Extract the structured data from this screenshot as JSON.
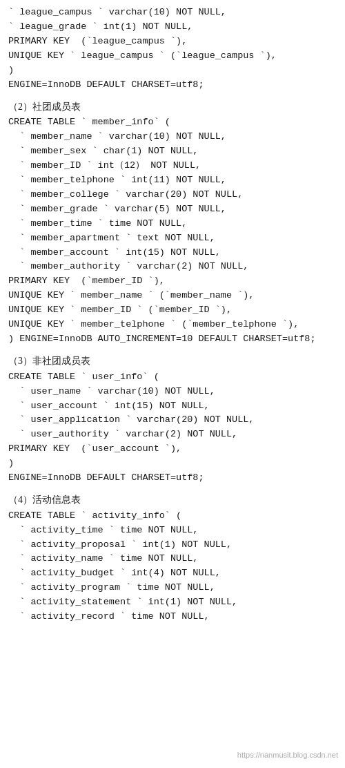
{
  "sections": [
    {
      "id": "top-fragment",
      "code_lines": [
        "` league_campus ` varchar(10) NOT NULL,",
        "` league_grade ` int(1) NOT NULL,",
        "PRIMARY KEY  (`league_campus `),",
        "UNIQUE KEY ` league_campus ` (`league_campus `),",
        ")",
        "ENGINE=InnoDB DEFAULT CHARSET=utf8;"
      ]
    },
    {
      "id": "section-2",
      "title": "（2）社团成员表",
      "code_lines": [
        "CREATE TABLE ` member_info` (",
        "  ` member_name ` varchar(10) NOT NULL,",
        "  ` member_sex ` char(1) NOT NULL,",
        "  ` member_ID ` int（12） NOT NULL,",
        "  ` member_telphone ` int(11) NOT NULL,",
        "  ` member_college ` varchar(20) NOT NULL,",
        "  ` member_grade ` varchar(5) NOT NULL,",
        "  ` member_time ` time NOT NULL,",
        "  ` member_apartment ` text NOT NULL,",
        "  ` member_account ` int(15) NOT NULL,",
        "  ` member_authority ` varchar(2) NOT NULL,",
        "PRIMARY KEY  (`member_ID `),",
        "UNIQUE KEY ` member_name ` (`member_name `),",
        "UNIQUE KEY ` member_ID ` (`member_ID `),",
        "UNIQUE KEY ` member_telphone ` (`member_telphone `),",
        ") ENGINE=InnoDB AUTO_INCREMENT=10 DEFAULT CHARSET=utf8;"
      ]
    },
    {
      "id": "section-3",
      "title": "（3）非社团成员表",
      "code_lines": [
        "CREATE TABLE ` user_info` (",
        "  ` user_name ` varchar(10) NOT NULL,",
        "  ` user_account ` int(15) NOT NULL,",
        "  ` user_application ` varchar(20) NOT NULL,",
        "  ` user_authority ` varchar(2) NOT NULL,",
        "PRIMARY KEY  (`user_account `),",
        ")",
        "ENGINE=InnoDB DEFAULT CHARSET=utf8;"
      ]
    },
    {
      "id": "section-4",
      "title": "（4）活动信息表",
      "code_lines": [
        "CREATE TABLE ` activity_info` (",
        "  ` activity_time ` time NOT NULL,",
        "  ` activity_proposal ` int(1) NOT NULL,",
        "  ` activity_name ` time NOT NULL,",
        "  ` activity_budget ` int(4) NOT NULL,",
        "  ` activity_program ` time NOT NULL,",
        "  ` activity_statement ` int(1) NOT NULL,",
        "  ` activity_record ` time NOT NULL,"
      ]
    }
  ],
  "watermark": "https://nanmusit.blog.csdn.net"
}
